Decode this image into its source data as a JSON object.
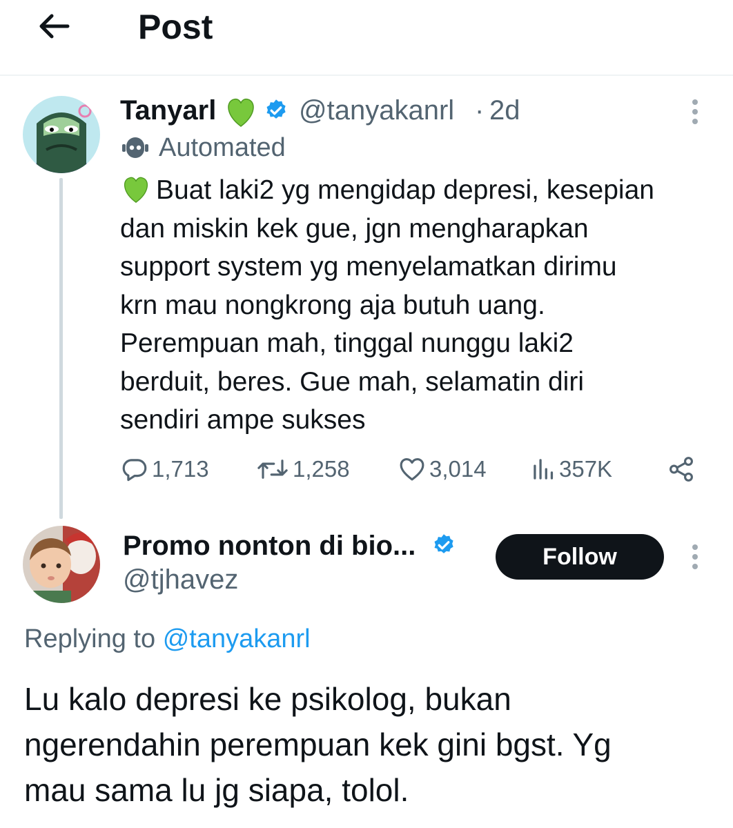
{
  "header": {
    "title": "Post",
    "back_icon": "arrow-left-icon"
  },
  "original_post": {
    "display_name": "Tanyarl",
    "name_emoji": "green-heart-icon",
    "verified": true,
    "handle": "@tanyakanrl",
    "separator": "·",
    "age": "2d",
    "label": "Automated",
    "label_icon": "robot-icon",
    "text_emoji": "green-heart-icon",
    "text": "Buat laki2 yg mengidap depresi, kesepian\ndan miskin kek gue, jgn mengharapkan\nsupport system yg menyelamatkan dirimu\nkrn mau nongkrong aja butuh uang.\nPerempuan mah, tinggal nunggu laki2\nberduit, beres. Gue mah, selamatin diri\nsendiri ampe sukses",
    "stats": {
      "replies": "1,713",
      "reposts": "1,258",
      "likes": "3,014",
      "views": "357K"
    }
  },
  "reply_post": {
    "display_name": "Promo nonton di bio...",
    "verified": true,
    "handle": "@tjhavez",
    "follow_label": "Follow",
    "replying_prefix": "Replying to",
    "replying_handle": "@tanyakanrl",
    "text": "Lu kalo depresi ke psikolog, bukan\nngerendahin perempuan kek gini bgst. Yg\nmau sama lu jg siapa, tolol."
  },
  "colors": {
    "accent": "#1d9bf0",
    "text": "#0f1419",
    "muted": "#536471",
    "heart": "#78c83c"
  }
}
